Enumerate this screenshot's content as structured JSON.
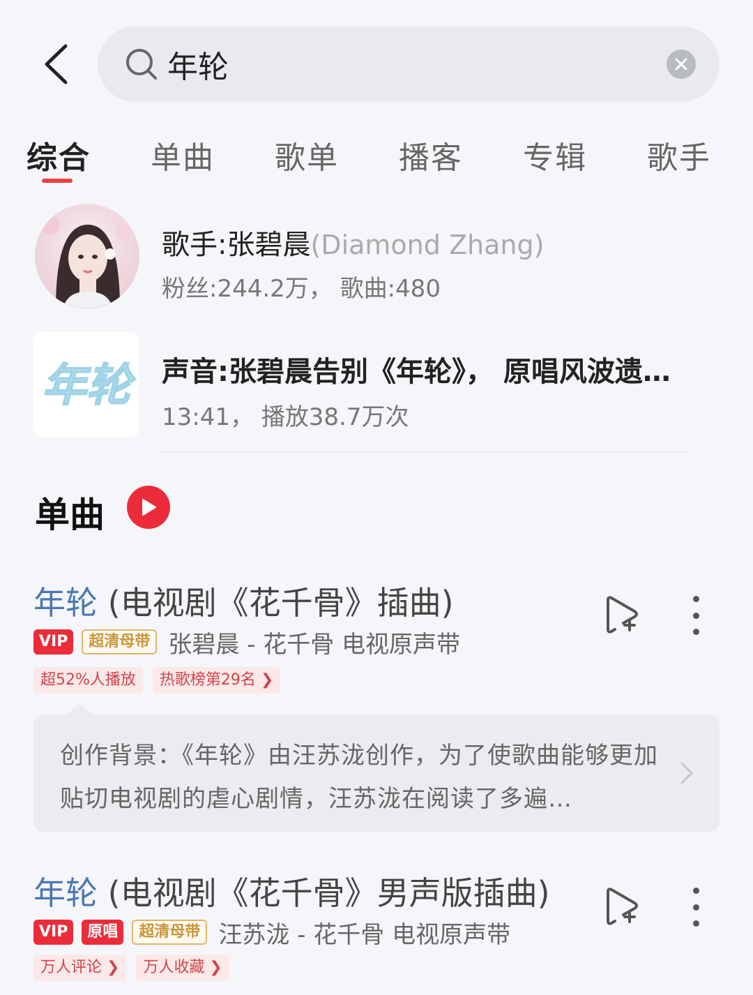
{
  "search": {
    "query": "年轮"
  },
  "tabs": [
    {
      "label": "综合",
      "active": true
    },
    {
      "label": "单曲",
      "active": false
    },
    {
      "label": "歌单",
      "active": false
    },
    {
      "label": "播客",
      "active": false
    },
    {
      "label": "专辑",
      "active": false
    },
    {
      "label": "歌手",
      "active": false
    }
  ],
  "artist": {
    "title": "歌手:张碧晨",
    "title_en": "(Diamond Zhang)",
    "meta": "粉丝:244.2万， 歌曲:480"
  },
  "audio": {
    "cover_text": "年轮",
    "title": "声音:张碧晨告别《年轮》， 原唱风波遗…",
    "meta": "13:41， 播放38.7万次"
  },
  "section": {
    "title": "单曲"
  },
  "songs": [
    {
      "title_highlight": "年轮",
      "title_rest": " (电视剧《花千骨》插曲)",
      "badges": [
        "VIP",
        "超清母带"
      ],
      "artist_album": "张碧晨 - 花千骨 电视原声带",
      "tags": [
        "超52%人播放",
        "热歌榜第29名 ❯"
      ],
      "background": "创作背景：《年轮》由汪苏泷创作，为了使歌曲能够更加贴切电视剧的虐心剧情，汪苏泷在阅读了多遍…"
    },
    {
      "title_highlight": "年轮",
      "title_rest": " (电视剧《花千骨》男声版插曲)",
      "badges": [
        "VIP",
        "原唱",
        "超清母带"
      ],
      "artist_album": "汪苏泷 - 花千骨 电视原声带",
      "tags": [
        "万人评论 ❯",
        "万人收藏 ❯"
      ]
    }
  ],
  "colors": {
    "accent": "#ec2c3a",
    "highlight": "#4a78b0",
    "background": "#f5f6fa"
  }
}
